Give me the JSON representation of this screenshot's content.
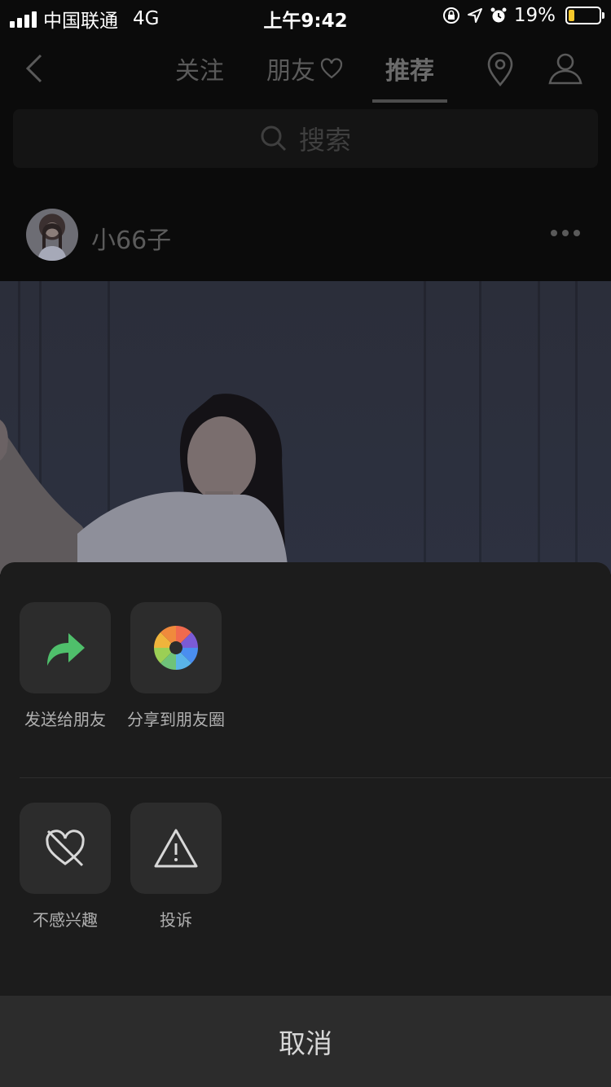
{
  "status_bar": {
    "carrier": "中国联通",
    "network": "4G",
    "time": "上午9:42",
    "battery": "19%",
    "battery_level": 0.19
  },
  "nav": {
    "tabs": [
      {
        "label": "关注"
      },
      {
        "label": "朋友"
      },
      {
        "label": "推荐"
      }
    ],
    "active_tab": "推荐"
  },
  "search": {
    "placeholder": "搜索"
  },
  "post": {
    "username": "小66子"
  },
  "sheet": {
    "share_actions": [
      {
        "label": "发送给朋友",
        "icon": "forward-arrow-icon"
      },
      {
        "label": "分享到朋友圈",
        "icon": "moments-shutter-icon"
      }
    ],
    "other_actions": [
      {
        "label": "不感兴趣",
        "icon": "broken-heart-icon"
      },
      {
        "label": "投诉",
        "icon": "warning-triangle-icon"
      }
    ],
    "cancel_label": "取消"
  },
  "colors": {
    "sheet_bg": "#1c1c1c",
    "tile_bg": "#2c2c2c",
    "forward_green": "#4fbf6b",
    "battery_yellow": "#f7c82b"
  }
}
